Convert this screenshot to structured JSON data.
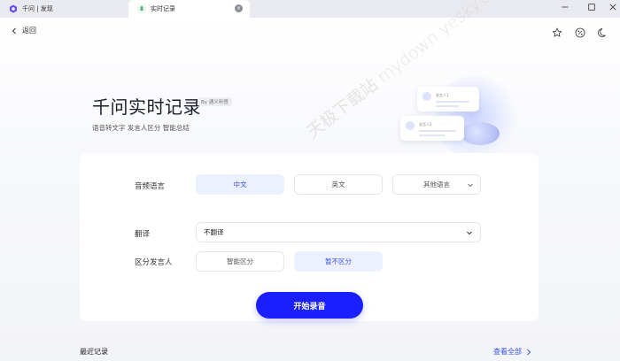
{
  "tabs": [
    {
      "label": "千问 | 发现"
    },
    {
      "label": "实时记录",
      "close": "×"
    }
  ],
  "page": {
    "back_label": "返回"
  },
  "hero": {
    "title": "千问实时记录",
    "badge": "By 通义听悟",
    "subtitle": "语音转文字 发言人区分 智能总结",
    "illustration": {
      "speaker1": "发言人1",
      "speaker2": "发言人2"
    }
  },
  "watermark": "天极下载站 mydown.yesky.com",
  "config": {
    "language": {
      "label": "音频语言",
      "options": [
        "中文",
        "英文"
      ],
      "selected": "中文",
      "other": "其他语言"
    },
    "translate": {
      "label": "翻译",
      "value": "不翻译"
    },
    "speaker": {
      "label": "区分发言人",
      "options": [
        "智能区分",
        "暂不区分"
      ],
      "selected": "暂不区分"
    },
    "start_button": "开始录音"
  },
  "recent": {
    "title": "最近记录",
    "view_all": "查看全部"
  },
  "colors": {
    "accent": "#1a1fff",
    "selected_bg": "#edf0ff",
    "selected_text": "#3550e6"
  }
}
